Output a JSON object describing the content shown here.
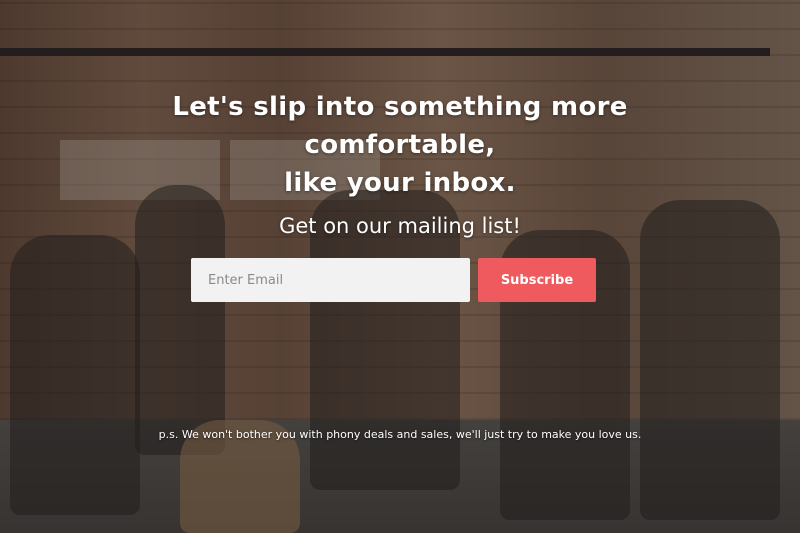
{
  "hero": {
    "headline_line1": "Let's slip into something more comfortable,",
    "headline_line2": "like your inbox.",
    "subheadline": "Get on our mailing list!",
    "footnote": "p.s. We won't bother you with phony deals and sales, we'll just try to make you love us."
  },
  "signup_form": {
    "email_placeholder": "Enter Email",
    "email_value": "",
    "subscribe_label": "Subscribe"
  },
  "colors": {
    "subscribe_button": "#ef5a5e",
    "input_background": "#f2f2f2",
    "text": "#ffffff"
  }
}
